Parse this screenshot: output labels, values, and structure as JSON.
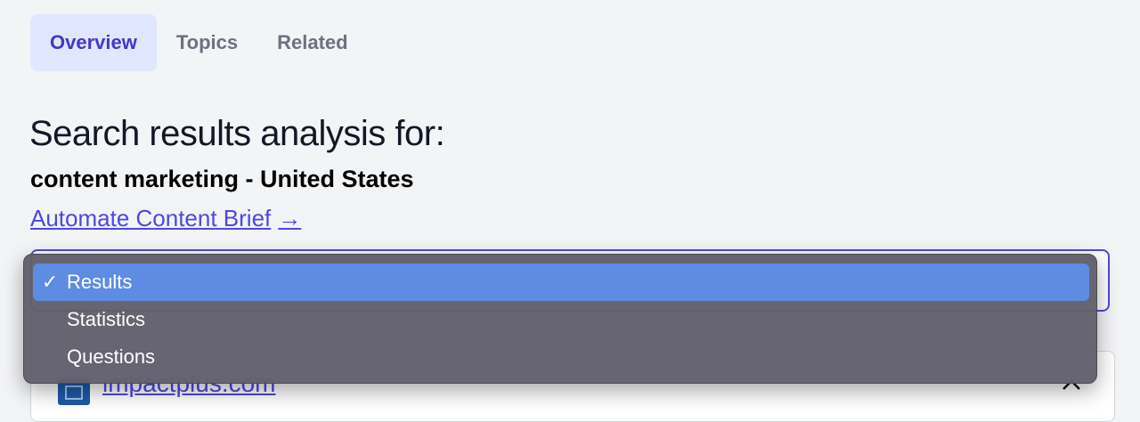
{
  "tabs": [
    {
      "label": "Overview",
      "active": true
    },
    {
      "label": "Topics",
      "active": false
    },
    {
      "label": "Related",
      "active": false
    }
  ],
  "heading": "Search results analysis for:",
  "subheading": "content marketing - United States",
  "brief_link": {
    "label": "Automate Content Brief",
    "arrow": "→"
  },
  "dropdown": {
    "selected": "Results",
    "options": [
      "Results",
      "Statistics",
      "Questions"
    ],
    "check_glyph": "✓"
  },
  "result_card": {
    "domain": "impactplus.com",
    "icon": "chevron-up-icon"
  },
  "colors": {
    "accent": "#4f46e5",
    "tab_active_bg": "#e0e7ff",
    "menu_bg": "#62606c",
    "menu_highlight": "#5e8ce3"
  }
}
